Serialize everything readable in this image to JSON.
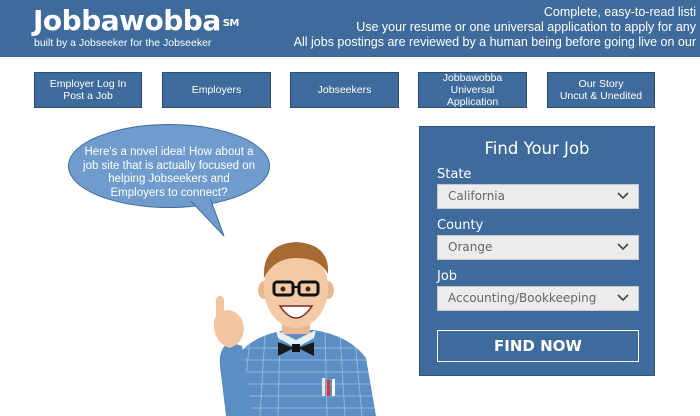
{
  "header": {
    "logo_text": "Jobbawobba",
    "logo_mark": "SM",
    "tagline": "built by a Jobseeker for the Jobseeker",
    "lines": [
      "Complete, easy-to-read listi",
      "Use your resume or one universal application to apply for any",
      "All jobs postings are reviewed by a human being before going live on our"
    ]
  },
  "nav": [
    {
      "label": "Employer Log In\nPost a Job"
    },
    {
      "label": "Employers"
    },
    {
      "label": "Jobseekers"
    },
    {
      "label": "Jobbawobba\nUniversal\nApplication"
    },
    {
      "label": "Our Story\nUncut & Unedited"
    }
  ],
  "bubble": {
    "text": "Here's a novel idea! How about a job site that is actually focused on helping Jobseekers and Employers to connect?"
  },
  "search": {
    "title": "Find Your Job",
    "state_label": "State",
    "state_value": "California",
    "county_label": "County",
    "county_value": "Orange",
    "job_label": "Job",
    "job_value": "Accounting/Bookkeeping",
    "button_label": "FIND NOW"
  },
  "colors": {
    "brand_blue": "#3e6b9c",
    "bubble_blue": "#6f9ccd",
    "select_bg": "#ececec"
  }
}
